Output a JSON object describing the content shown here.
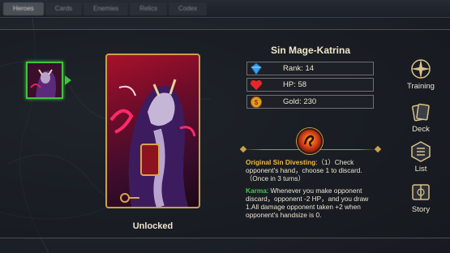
{
  "tabs": [
    {
      "label": "Heroes",
      "active": true
    },
    {
      "label": "Cards",
      "active": false
    },
    {
      "label": "Enemies",
      "active": false
    },
    {
      "label": "Relics",
      "active": false
    },
    {
      "label": "Codex",
      "active": false
    }
  ],
  "hero": {
    "name": "Sin Mage-Katrina",
    "status": "Unlocked",
    "stats": {
      "rank": "Rank: 14",
      "hp": "HP: 58",
      "gold": "Gold: 230"
    },
    "skills": {
      "original_sin": {
        "name": "Original Sin Divesting",
        "text": ":（1）Check opponent's hand，choose 1 to discard.（Once in 3 turns）"
      },
      "karma": {
        "name": "Karma",
        "text": ":  Whenever you make opponent discard，opponent -2 HP，and you draw 1.All damage opponent taken +2 when opponent's handsize is 0."
      }
    }
  },
  "menu": {
    "training": "Training",
    "deck": "Deck",
    "list": "List",
    "story": "Story"
  },
  "colors": {
    "accent_gold": "#c9a04a",
    "selected_green": "#3fc43a",
    "skill_orange": "#f0b93c",
    "skill_green": "#45c84a"
  }
}
